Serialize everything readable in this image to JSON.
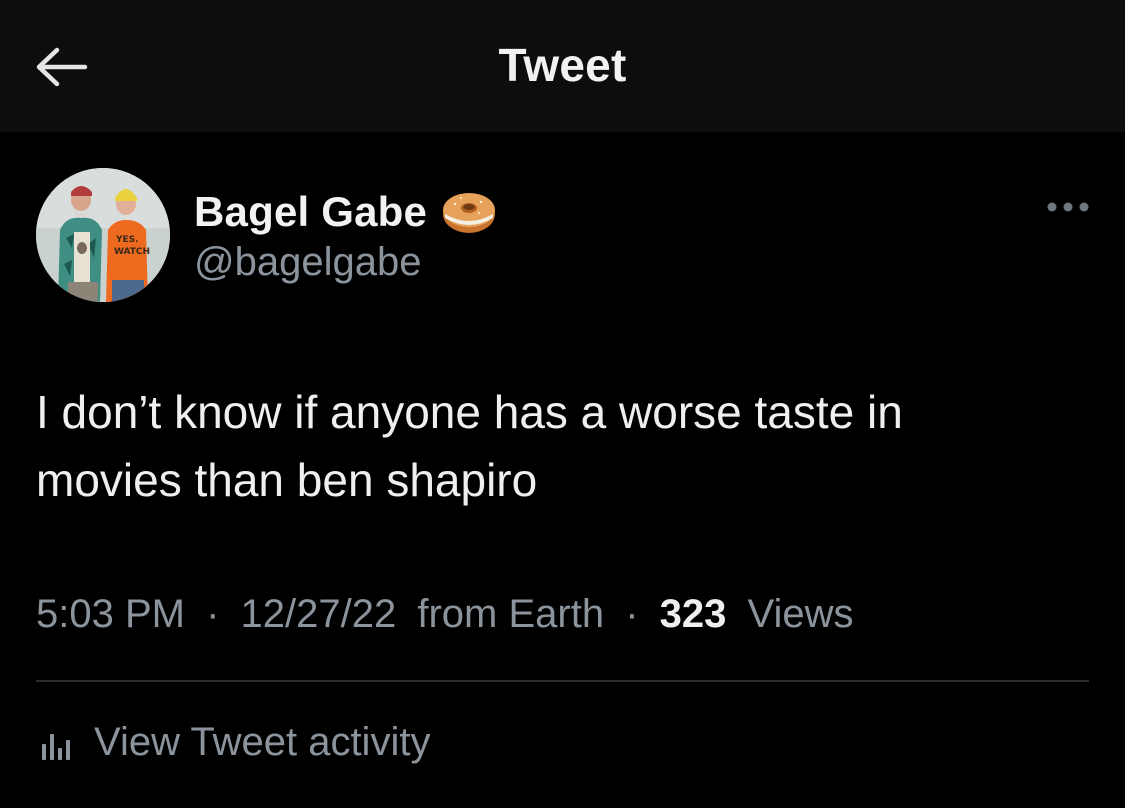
{
  "topbar": {
    "title": "Tweet",
    "back_icon": "arrow-left-icon"
  },
  "tweet": {
    "author": {
      "display_name": "Bagel Gabe",
      "handle": "@bagelgabe",
      "badge_icon": "bagel-emoji-icon",
      "avatar": "profile-photo"
    },
    "more_icon": "more-horizontal-icon",
    "text": "I don’t know if anyone has a worse taste in\nmovies than ben shapiro",
    "time": "5:03 PM",
    "date": "12/27/22",
    "source": "from Earth",
    "separator": "·",
    "views_count": "323",
    "views_label": "Views"
  },
  "activity": {
    "icon": "bar-chart-icon",
    "label": "View Tweet activity"
  },
  "colors": {
    "background": "#000000",
    "topbar": "#0d0d0d",
    "text_primary": "#efefef",
    "text_secondary": "#8b949c",
    "divider": "#2a2d30"
  }
}
